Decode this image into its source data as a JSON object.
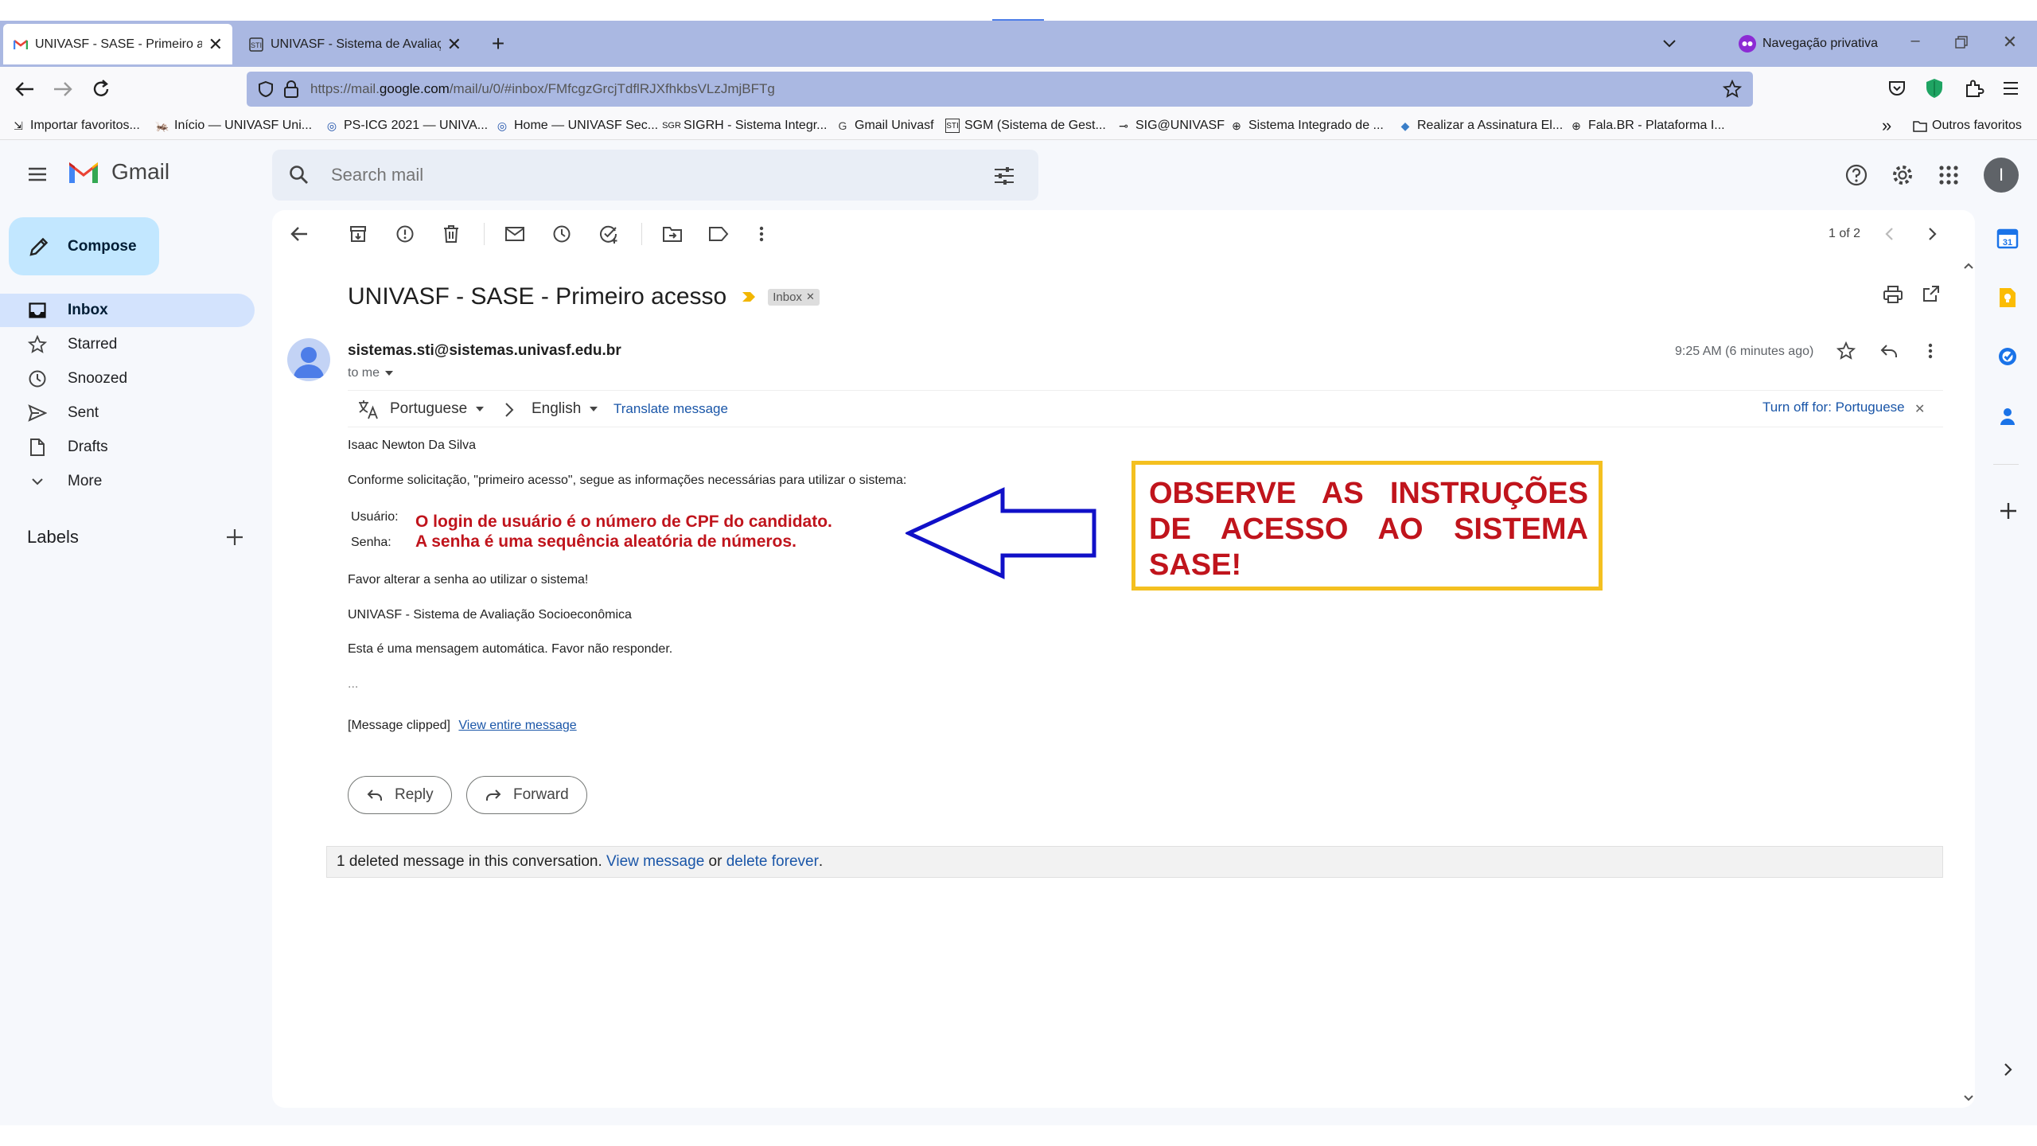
{
  "browser": {
    "tabs": [
      {
        "title": "UNIVASF - SASE - Primeiro aces"
      },
      {
        "title": "UNIVASF - Sistema de Avaliação"
      }
    ],
    "private_label": "Navegação privativa",
    "url_prefix": "https://mail.",
    "url_domain": "google.com",
    "url_path": "/mail/u/0/#inbox/FMfcgzGrcjTdflRJXfhkbsVLzJmjBFTg",
    "bookmarks": [
      {
        "label": "Importar favoritos..."
      },
      {
        "label": "Início — UNIVASF Uni..."
      },
      {
        "label": "PS-ICG 2021 — UNIVA..."
      },
      {
        "label": "Home — UNIVASF Sec..."
      },
      {
        "label": "SIGRH - Sistema Integr..."
      },
      {
        "label": "Gmail Univasf"
      },
      {
        "label": "SGM (Sistema de Gest..."
      },
      {
        "label": "SIG@UNIVASF"
      },
      {
        "label": "Sistema Integrado de ..."
      },
      {
        "label": "Realizar a Assinatura El..."
      },
      {
        "label": "Fala.BR - Plataforma I..."
      }
    ],
    "other_bookmarks": "Outros favoritos"
  },
  "gmail": {
    "logo_text": "Gmail",
    "search_placeholder": "Search mail",
    "avatar_letter": "I",
    "compose_label": "Compose",
    "nav": [
      {
        "label": "Inbox"
      },
      {
        "label": "Starred"
      },
      {
        "label": "Snoozed"
      },
      {
        "label": "Sent"
      },
      {
        "label": "Drafts"
      },
      {
        "label": "More"
      }
    ],
    "labels_heading": "Labels",
    "pagination": "1 of 2"
  },
  "email": {
    "subject": "UNIVASF - SASE - Primeiro acesso",
    "inbox_tag": "Inbox",
    "sender": "sistemas.sti@sistemas.univasf.edu.br",
    "to": "to me",
    "time": "9:25 AM (6 minutes ago)",
    "translate": {
      "from_lang": "Portuguese",
      "to_lang": "English",
      "translate_link": "Translate message",
      "turn_off": "Turn off for: Portuguese"
    },
    "body": {
      "greeting": "Isaac Newton Da Silva",
      "intro": "Conforme solicitação, \"primeiro acesso\", segue as informações necessárias para utilizar o sistema:",
      "user_label": "Usuário:",
      "user_value": "O login de usuário é o número de CPF do candidato.",
      "pass_label": "Senha:",
      "pass_value": "A senha é uma sequência aleatória de números.",
      "change_pw": "Favor alterar a senha ao utilizar o sistema!",
      "system_name": "UNIVASF - Sistema de Avaliação Socioeconômica",
      "auto_msg": "Esta é uma mensagem automática. Favor não responder.",
      "ellipsis": "...",
      "clipped": "[Message clipped]",
      "view_entire": "View entire message"
    },
    "reply_label": "Reply",
    "forward_label": "Forward",
    "deleted_notice": {
      "text": "1 deleted message in this conversation.",
      "view_link": "View message",
      "or": "or",
      "delete_link": "delete forever",
      "period": "."
    }
  },
  "annotation": {
    "callout_line1": "OBSERVE AS INSTRUÇÕES",
    "callout_line2": "DE ACESSO AO SISTEMA",
    "callout_line3": "SASE!",
    "border_color": "#f4c020",
    "text_color": "#c0141c",
    "arrow_color": "#1010c8"
  }
}
